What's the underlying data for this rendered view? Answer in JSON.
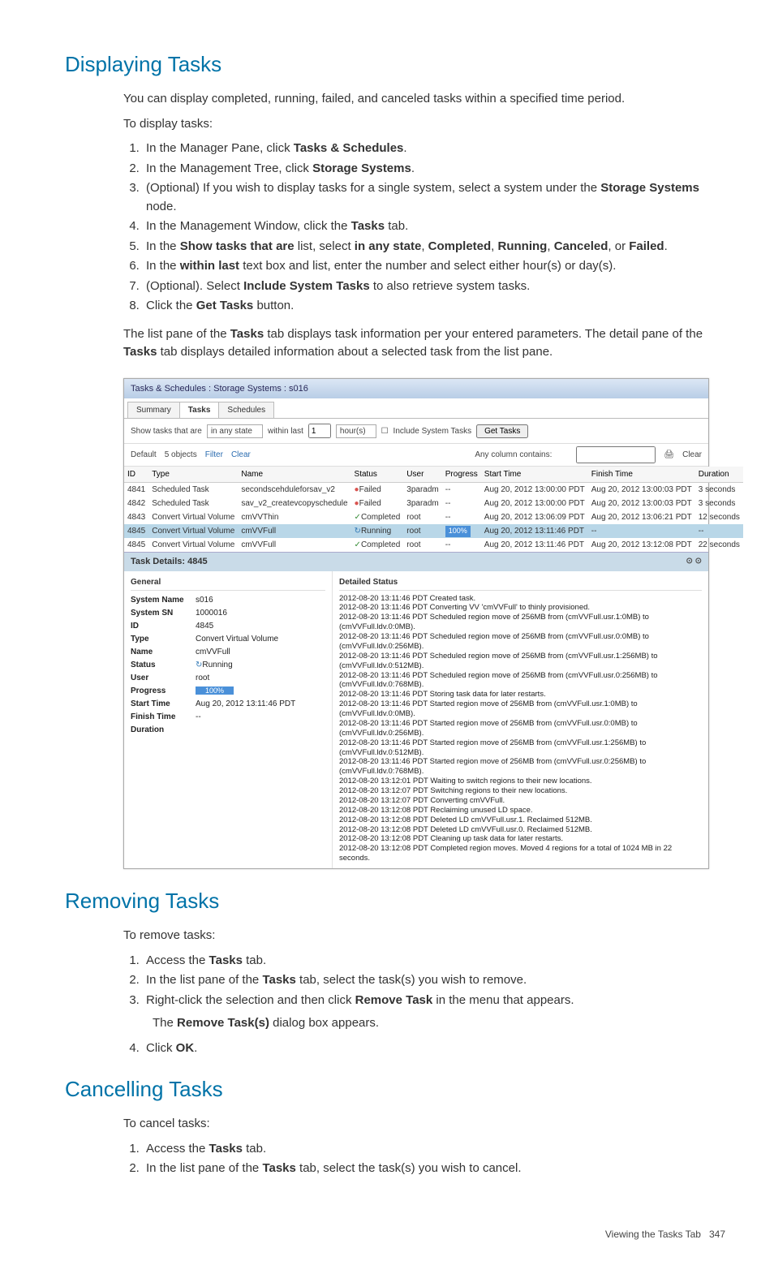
{
  "sections": {
    "displaying": {
      "heading": "Displaying Tasks",
      "intro": "You can display completed, running, failed, and canceled tasks within a specified time period.",
      "lead": "To display tasks:",
      "steps": [
        [
          "In the Manager Pane, click ",
          "Tasks & Schedules",
          "."
        ],
        [
          "In the Management Tree, click ",
          "Storage Systems",
          "."
        ],
        [
          "(Optional) If you wish to display tasks for a single system, select a system under the ",
          "Storage Systems",
          " node."
        ],
        [
          "In the Management Window, click the ",
          "Tasks",
          " tab."
        ],
        [
          "In the ",
          "Show tasks that are",
          " list, select ",
          "in any state",
          ", ",
          "Completed",
          ", ",
          "Running",
          ", ",
          "Canceled",
          ", or ",
          "Failed",
          "."
        ],
        [
          "In the ",
          "within last",
          " text box and list, enter the number and select either hour(s) or day(s)."
        ],
        [
          "(Optional). Select ",
          "Include System Tasks",
          " to also retrieve system tasks."
        ],
        [
          "Click the ",
          "Get Tasks",
          " button."
        ]
      ],
      "outro1": [
        "The list pane of the ",
        "Tasks",
        " tab displays task information per your entered parameters. The detail pane of the ",
        "Tasks",
        " tab displays detailed information about a selected task from the list pane."
      ]
    },
    "removing": {
      "heading": "Removing Tasks",
      "lead": "To remove tasks:",
      "steps": [
        [
          "Access the ",
          "Tasks",
          " tab."
        ],
        [
          "In the list pane of the ",
          "Tasks",
          " tab, select the task(s) you wish to remove."
        ],
        [
          "Right-click the selection and then click ",
          "Remove Task",
          " in the menu that appears."
        ],
        [
          "Click ",
          "OK",
          "."
        ]
      ],
      "substep": [
        "The ",
        "Remove Task(s)",
        " dialog box appears."
      ]
    },
    "cancelling": {
      "heading": "Cancelling Tasks",
      "lead": "To cancel tasks:",
      "steps": [
        [
          "Access the ",
          "Tasks",
          " tab."
        ],
        [
          "In the list pane of the ",
          "Tasks",
          " tab, select the task(s) you wish to cancel."
        ]
      ]
    }
  },
  "screenshot": {
    "titlebar": "Tasks & Schedules : Storage Systems : s016",
    "tabs": [
      "Summary",
      "Tasks",
      "Schedules"
    ],
    "active_tab": "Tasks",
    "toolbar": {
      "label1": "Show tasks that are",
      "state": "in any state",
      "label2": "within last",
      "num": "1",
      "unit": "hour(s)",
      "include_label": "Include System Tasks",
      "button": "Get Tasks"
    },
    "filterbar": {
      "default": "Default",
      "objects": "5 objects",
      "filter": "Filter",
      "clear_left": "Clear",
      "contains": "Any column contains:",
      "clear_right": "Clear"
    },
    "columns": [
      "ID",
      "Type",
      "Name",
      "Status",
      "User",
      "Progress",
      "Start Time",
      "Finish Time",
      "Duration"
    ],
    "rows": [
      {
        "id": "4841",
        "type": "Scheduled Task",
        "name": "secondscehduleforsav_v2",
        "status": "Failed",
        "user": "3paradm",
        "progress": "--",
        "start": "Aug 20, 2012 13:00:00 PDT",
        "finish": "Aug 20, 2012 13:00:03 PDT",
        "duration": "3 seconds",
        "hl": false
      },
      {
        "id": "4842",
        "type": "Scheduled Task",
        "name": "sav_v2_createvcopyschedule",
        "status": "Failed",
        "user": "3paradm",
        "progress": "--",
        "start": "Aug 20, 2012 13:00:00 PDT",
        "finish": "Aug 20, 2012 13:00:03 PDT",
        "duration": "3 seconds",
        "hl": false
      },
      {
        "id": "4843",
        "type": "Convert Virtual Volume",
        "name": "cmVVThin",
        "status": "Completed",
        "user": "root",
        "progress": "--",
        "start": "Aug 20, 2012 13:06:09 PDT",
        "finish": "Aug 20, 2012 13:06:21 PDT",
        "duration": "12 seconds",
        "hl": false
      },
      {
        "id": "4845",
        "type": "Convert Virtual Volume",
        "name": "cmVVFull",
        "status": "Running",
        "user": "root",
        "progress": "100%",
        "start": "Aug 20, 2012 13:11:46 PDT",
        "finish": "--",
        "duration": "--",
        "hl": true
      },
      {
        "id": "4845",
        "type": "Convert Virtual Volume",
        "name": "cmVVFull",
        "status": "Completed",
        "user": "root",
        "progress": "--",
        "start": "Aug 20, 2012 13:11:46 PDT",
        "finish": "Aug 20, 2012 13:12:08 PDT",
        "duration": "22 seconds",
        "hl": false
      }
    ],
    "details": {
      "title": "Task Details: 4845",
      "general_label": "General",
      "detailed_label": "Detailed Status",
      "kv": [
        [
          "System Name",
          "s016"
        ],
        [
          "System SN",
          "1000016"
        ],
        [
          "ID",
          "4845"
        ],
        [
          "Type",
          "Convert Virtual Volume"
        ],
        [
          "Name",
          "cmVVFull"
        ],
        [
          "Status",
          "Running"
        ],
        [
          "User",
          "root"
        ],
        [
          "Progress",
          "100%"
        ],
        [
          "Start Time",
          "Aug 20, 2012 13:11:46 PDT"
        ],
        [
          "Finish Time",
          "--"
        ],
        [
          "Duration",
          ""
        ]
      ],
      "log": "2012-08-20 13:11:46 PDT Created task.\n2012-08-20 13:11:46 PDT Converting VV 'cmVVFull' to thinly provisioned.\n2012-08-20 13:11:46 PDT Scheduled region move of 256MB from (cmVVFull.usr.1:0MB) to (cmVVFull.ldv.0:0MB).\n2012-08-20 13:11:46 PDT Scheduled region move of 256MB from (cmVVFull.usr.0:0MB) to (cmVVFull.ldv.0:256MB).\n2012-08-20 13:11:46 PDT Scheduled region move of 256MB from (cmVVFull.usr.1:256MB) to (cmVVFull.ldv.0:512MB).\n2012-08-20 13:11:46 PDT Scheduled region move of 256MB from (cmVVFull.usr.0:256MB) to (cmVVFull.ldv.0:768MB).\n2012-08-20 13:11:46 PDT Storing task data for later restarts.\n2012-08-20 13:11:46 PDT Started region move of 256MB from (cmVVFull.usr.1:0MB) to (cmVVFull.ldv.0:0MB).\n2012-08-20 13:11:46 PDT Started region move of 256MB from (cmVVFull.usr.0:0MB) to (cmVVFull.ldv.0:256MB).\n2012-08-20 13:11:46 PDT Started region move of 256MB from (cmVVFull.usr.1:256MB) to (cmVVFull.ldv.0:512MB).\n2012-08-20 13:11:46 PDT Started region move of 256MB from (cmVVFull.usr.0:256MB) to (cmVVFull.ldv.0:768MB).\n2012-08-20 13:12:01 PDT Waiting to switch regions to their new locations.\n2012-08-20 13:12:07 PDT Switching regions to their new locations.\n2012-08-20 13:12:07 PDT Converting cmVVFull.\n2012-08-20 13:12:08 PDT Reclaiming unused LD space.\n2012-08-20 13:12:08 PDT Deleted LD cmVVFull.usr.1. Reclaimed 512MB.\n2012-08-20 13:12:08 PDT Deleted LD cmVVFull.usr.0. Reclaimed 512MB.\n2012-08-20 13:12:08 PDT Cleaning up task data for later restarts.\n2012-08-20 13:12:08 PDT Completed region moves. Moved 4 regions for a total of 1024 MB in 22 seconds."
    }
  },
  "footer": {
    "label": "Viewing the Tasks Tab",
    "page": "347"
  }
}
